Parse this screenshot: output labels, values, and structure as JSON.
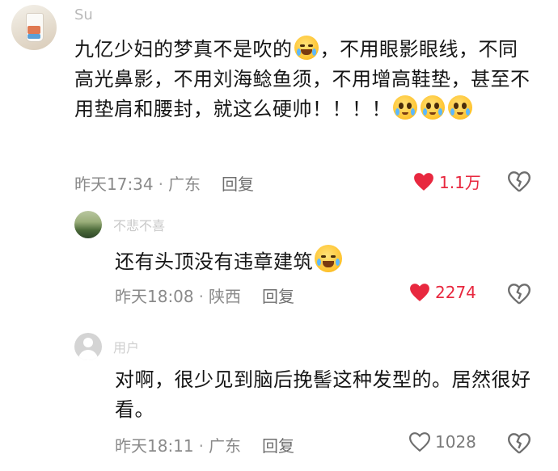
{
  "comments": [
    {
      "username": "Su",
      "text_parts": [
        "九亿少妇的梦真不是吹的",
        "，不用眼影眼线，不同高光鼻影，不用刘海鲶鱼须，不用增高鞋垫，甚至不用垫肩和腰封，就这么硬帅！！！！"
      ],
      "time": "昨天17:34",
      "location": "广东",
      "reply_label": "回复",
      "likes": "1.1万",
      "liked": true
    },
    {
      "username": "不悲不喜",
      "text": "还有头顶没有违章建筑",
      "time": "昨天18:08",
      "location": "陕西",
      "reply_label": "回复",
      "likes": "2274",
      "liked": true
    },
    {
      "username": "用户",
      "text": "对啊，很少见到脑后挽髻这种发型的。居然很好看。",
      "time": "昨天18:11",
      "location": "广东",
      "reply_label": "回复",
      "likes": "1028",
      "liked": false
    }
  ],
  "colors": {
    "like_active": "#e8283f",
    "meta_gray": "#8a8a8a",
    "username_gray": "#b9b9b9"
  },
  "icons": {
    "like": "heart-icon",
    "dislike": "broken-heart-icon",
    "emoji_laugh": "laughing-crying-emoji",
    "emoji_pleading": "pleading-crying-emoji"
  }
}
